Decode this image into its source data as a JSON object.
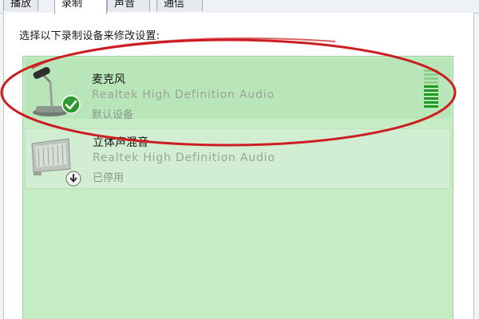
{
  "tabs": [
    {
      "label": "播放",
      "active": false
    },
    {
      "label": "录制",
      "active": true
    },
    {
      "label": "声音",
      "active": false
    },
    {
      "label": "通信",
      "active": false
    }
  ],
  "instruction": "选择以下录制设备来修改设置:",
  "devices": [
    {
      "name": "麦克风",
      "driver": "Realtek High Definition Audio",
      "status": "默认设备",
      "icon": "microphone-icon",
      "badge": "default-checkmark-icon",
      "level": 0.55,
      "selected": true
    },
    {
      "name": "立体声混音",
      "driver": "Realtek High Definition Audio",
      "status": "已停用",
      "icon": "sound-card-icon",
      "badge": "disabled-arrow-icon",
      "selected": false
    }
  ],
  "colors": {
    "list_bg": "#c6ecc6",
    "selected_bg": "#b8e6b8",
    "annotation_red": "#cc1d22",
    "check_green": "#2d9a2d"
  }
}
